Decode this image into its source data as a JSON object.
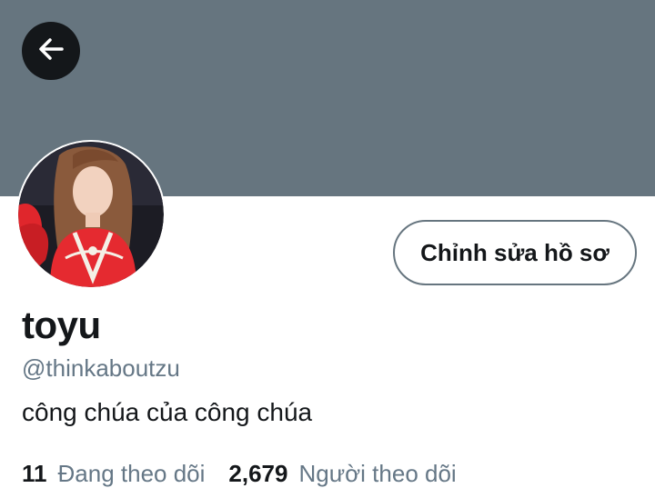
{
  "header": {
    "back_icon": "arrow-left-icon",
    "banner_color": "#66757f"
  },
  "profile": {
    "avatar_desc": "avatar",
    "display_name": "toyu",
    "handle": "@thinkaboutzu",
    "bio": "công chúa của công chúa",
    "edit_button_label": "Chỉnh sửa hồ sơ"
  },
  "stats": {
    "following_count": "11",
    "following_label": "Đang theo dõi",
    "followers_count": "2,679",
    "followers_label": "Người theo dõi"
  },
  "colors": {
    "text_primary": "#14171a",
    "text_secondary": "#657786",
    "back_button_bg": "#14171a"
  }
}
